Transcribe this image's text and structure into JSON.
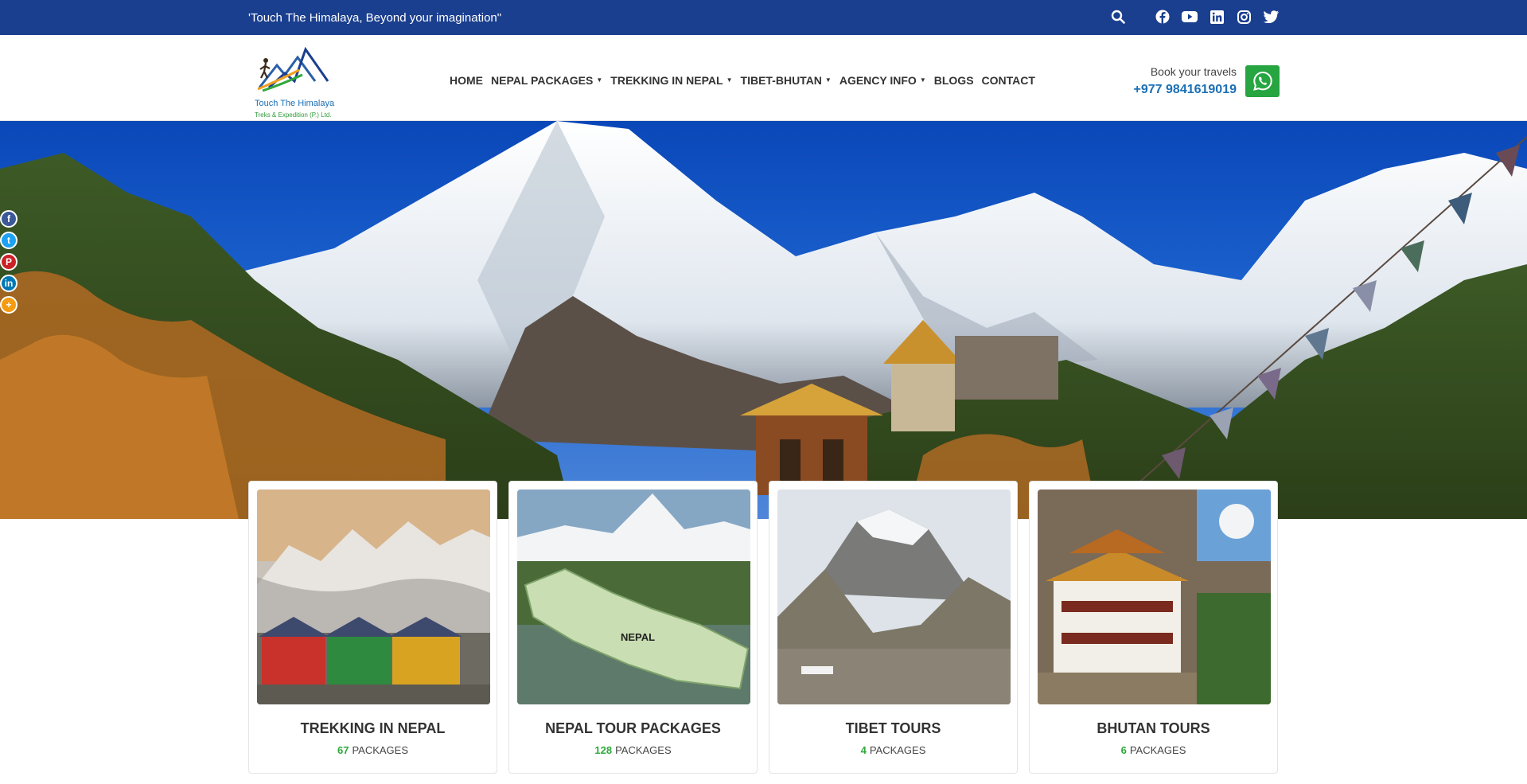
{
  "topbar": {
    "tagline": "'Touch The Himalaya, Beyond your imagination\"",
    "icons": [
      "search-icon",
      "facebook-icon",
      "youtube-icon",
      "linkedin-icon",
      "instagram-icon",
      "twitter-icon"
    ]
  },
  "logo": {
    "brand": "Touch The Himalaya",
    "sub": "Treks & Expedition (P.) Ltd."
  },
  "nav": {
    "items": [
      {
        "label": "HOME",
        "dropdown": false
      },
      {
        "label": "NEPAL PACKAGES",
        "dropdown": true
      },
      {
        "label": "TREKKING IN NEPAL",
        "dropdown": true
      },
      {
        "label": "TIBET-BHUTAN",
        "dropdown": true
      },
      {
        "label": "AGENCY INFO",
        "dropdown": true
      },
      {
        "label": "BLOGS",
        "dropdown": false
      },
      {
        "label": "CONTACT",
        "dropdown": false
      }
    ]
  },
  "booking": {
    "label": "Book your travels",
    "phone": "+977 9841619019"
  },
  "social_side": [
    "facebook-icon",
    "twitter-icon",
    "pinterest-icon",
    "linkedin-icon",
    "more-icon"
  ],
  "cards": [
    {
      "title": "TREKKING IN NEPAL",
      "count": "67",
      "unit": "PACKAGES"
    },
    {
      "title": "NEPAL TOUR PACKAGES",
      "count": "128",
      "unit": "PACKAGES"
    },
    {
      "title": "TIBET TOURS",
      "count": "4",
      "unit": "PACKAGES"
    },
    {
      "title": "BHUTAN TOURS",
      "count": "6",
      "unit": "PACKAGES"
    }
  ],
  "map_label": "NEPAL",
  "colors": {
    "topbar": "#1b3f8f",
    "accent_green": "#2ea83a",
    "whatsapp": "#26a541",
    "phone_blue": "#1b6fb5"
  }
}
